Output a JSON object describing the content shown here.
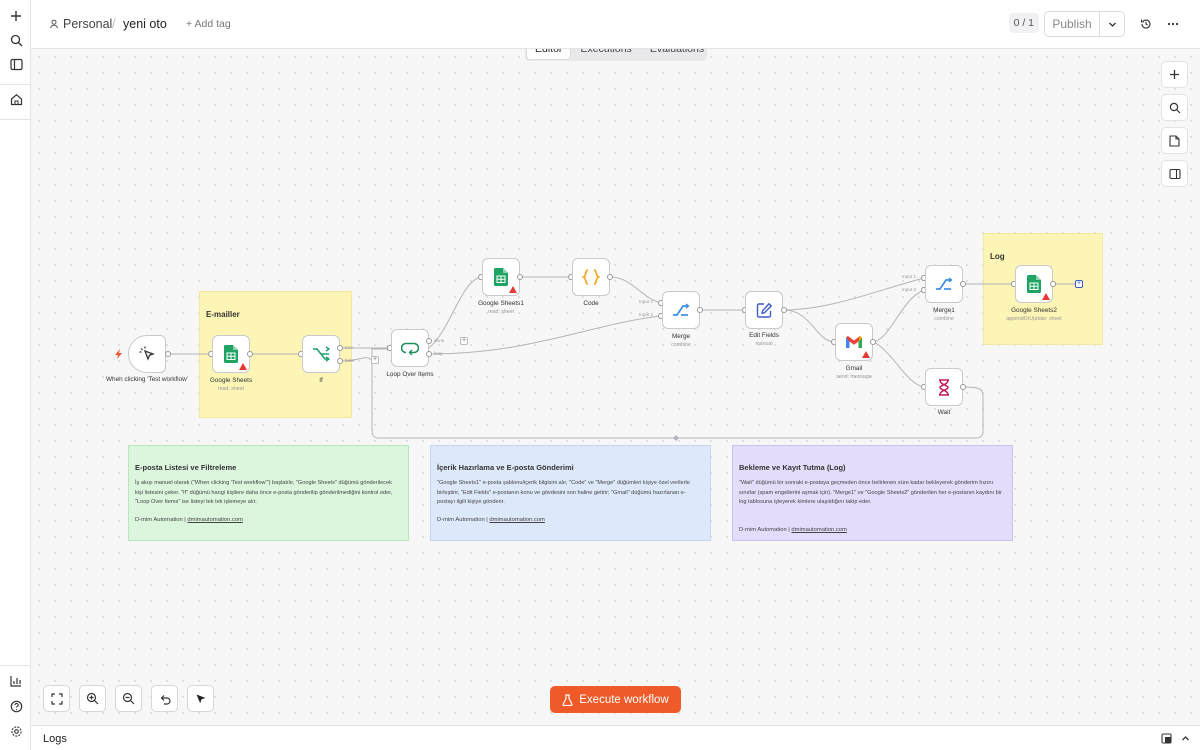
{
  "header": {
    "breadcrumb_owner": "Personal",
    "breadcrumb_separator": "/",
    "workflow_name": "yeni oto",
    "add_tag": "+ Add tag",
    "version_counter": "0 / 1",
    "publish_label": "Publish"
  },
  "tabs": [
    {
      "label": "Editor",
      "active": true
    },
    {
      "label": "Executions",
      "active": false
    },
    {
      "label": "Evaluations",
      "active": false
    }
  ],
  "groups": {
    "emailer": "E-mailler",
    "log": "Log"
  },
  "nodes": {
    "trigger": {
      "label": "When clicking 'Test workflow'"
    },
    "sheets": {
      "label": "Google Sheets",
      "sub": "read: sheet"
    },
    "if": {
      "label": "If"
    },
    "loop": {
      "label": "Loop Over Items"
    },
    "sheets1": {
      "label": "Google Sheets1",
      "sub": "read: sheet"
    },
    "code": {
      "label": "Code"
    },
    "merge": {
      "label": "Merge",
      "sub": "combine"
    },
    "edit": {
      "label": "Edit Fields",
      "sub": "manual"
    },
    "gmail": {
      "label": "Gmail",
      "sub": "send: message"
    },
    "merge1": {
      "label": "Merge1",
      "sub": "combine"
    },
    "wait": {
      "label": "Wait"
    },
    "sheets2": {
      "label": "Google Sheets2",
      "sub": "appendOrUpdate: sheet"
    }
  },
  "ports": {
    "if_true": "true",
    "if_false": "false",
    "loop_done": "done",
    "loop_loop": "loop",
    "merge_in1": "Input 1",
    "merge_in2": "Input 2",
    "merge1_in1": "Input 1",
    "merge1_in2": "Input 2"
  },
  "notes": [
    {
      "title": "E-posta Listesi ve Filtreleme",
      "body": "İş akışı manuel olarak (\"When clicking 'Test workflow'\") başlatılır, \"Google Sheets\" düğümü gönderilecek kişi listesini çeker. \"If\" düğümü hangi kişilere daha önce e-posta gönderilip gönderilmediğini kontrol eder, \"Loop Over Items\" ise listeyi tek tek işlemeye alır.",
      "footer_prefix": "D-mim Automation |",
      "footer_link": "dmimautomation.com"
    },
    {
      "title": "İçerik Hazırlama ve E-posta Gönderimi",
      "body": "\"Google Sheets1\" e-posta şablonu/içerik bilgisini alır, \"Code\" ve \"Merge\" düğümleri kişiye özel verilerle birleştirir, \"Edit Fields\" e-postanın konu ve gövdesini son haline getirir; \"Gmail\" düğümü hazırlanan e-postayı ilgili kişiye gönderir.",
      "footer_prefix": "D-mim Automation |",
      "footer_link": "dmimautomation.com"
    },
    {
      "title": "Bekleme ve Kayıt Tutma (Log)",
      "body": "\"Wait\" düğümü bir sonraki e-postaya geçmeden önce belirlenen süre kadar bekleyerek gönderim hızını sınırlar (spam engellerini aşmak için). \"Merge1\" ve \"Google Sheets2\" gönderilen her e-postanın kaydını bir log tablosuna işleyerek kimlere ulaşıldığını takip eder.",
      "footer_prefix": "D-mim Automation |",
      "footer_link": "dmimautomation.com"
    }
  ],
  "execute_label": "Execute workflow",
  "logs_label": "Logs",
  "colors": {
    "execute": "#f05a28",
    "sheets_green": "#1fa463",
    "warning": "#e53935",
    "code_orange": "#f5a623",
    "merge_blue": "#3b8ee8",
    "edit_blue": "#3b5cc7",
    "if_green": "#1e9e6a",
    "loop_green": "#1e8e5a",
    "wait_pink": "#c2185b"
  },
  "icons": {
    "rail": [
      "plus-icon",
      "search-icon",
      "panel-icon",
      "home-icon",
      "insights-icon",
      "help-icon",
      "settings-icon"
    ],
    "header": [
      "user-icon",
      "chevron-down-icon",
      "history-icon",
      "more-icon"
    ],
    "canvas_tools": [
      "zoom-to-fit-icon",
      "zoom-in-icon",
      "zoom-out-icon",
      "undo-icon",
      "cursor-icon",
      "flask-icon"
    ]
  }
}
